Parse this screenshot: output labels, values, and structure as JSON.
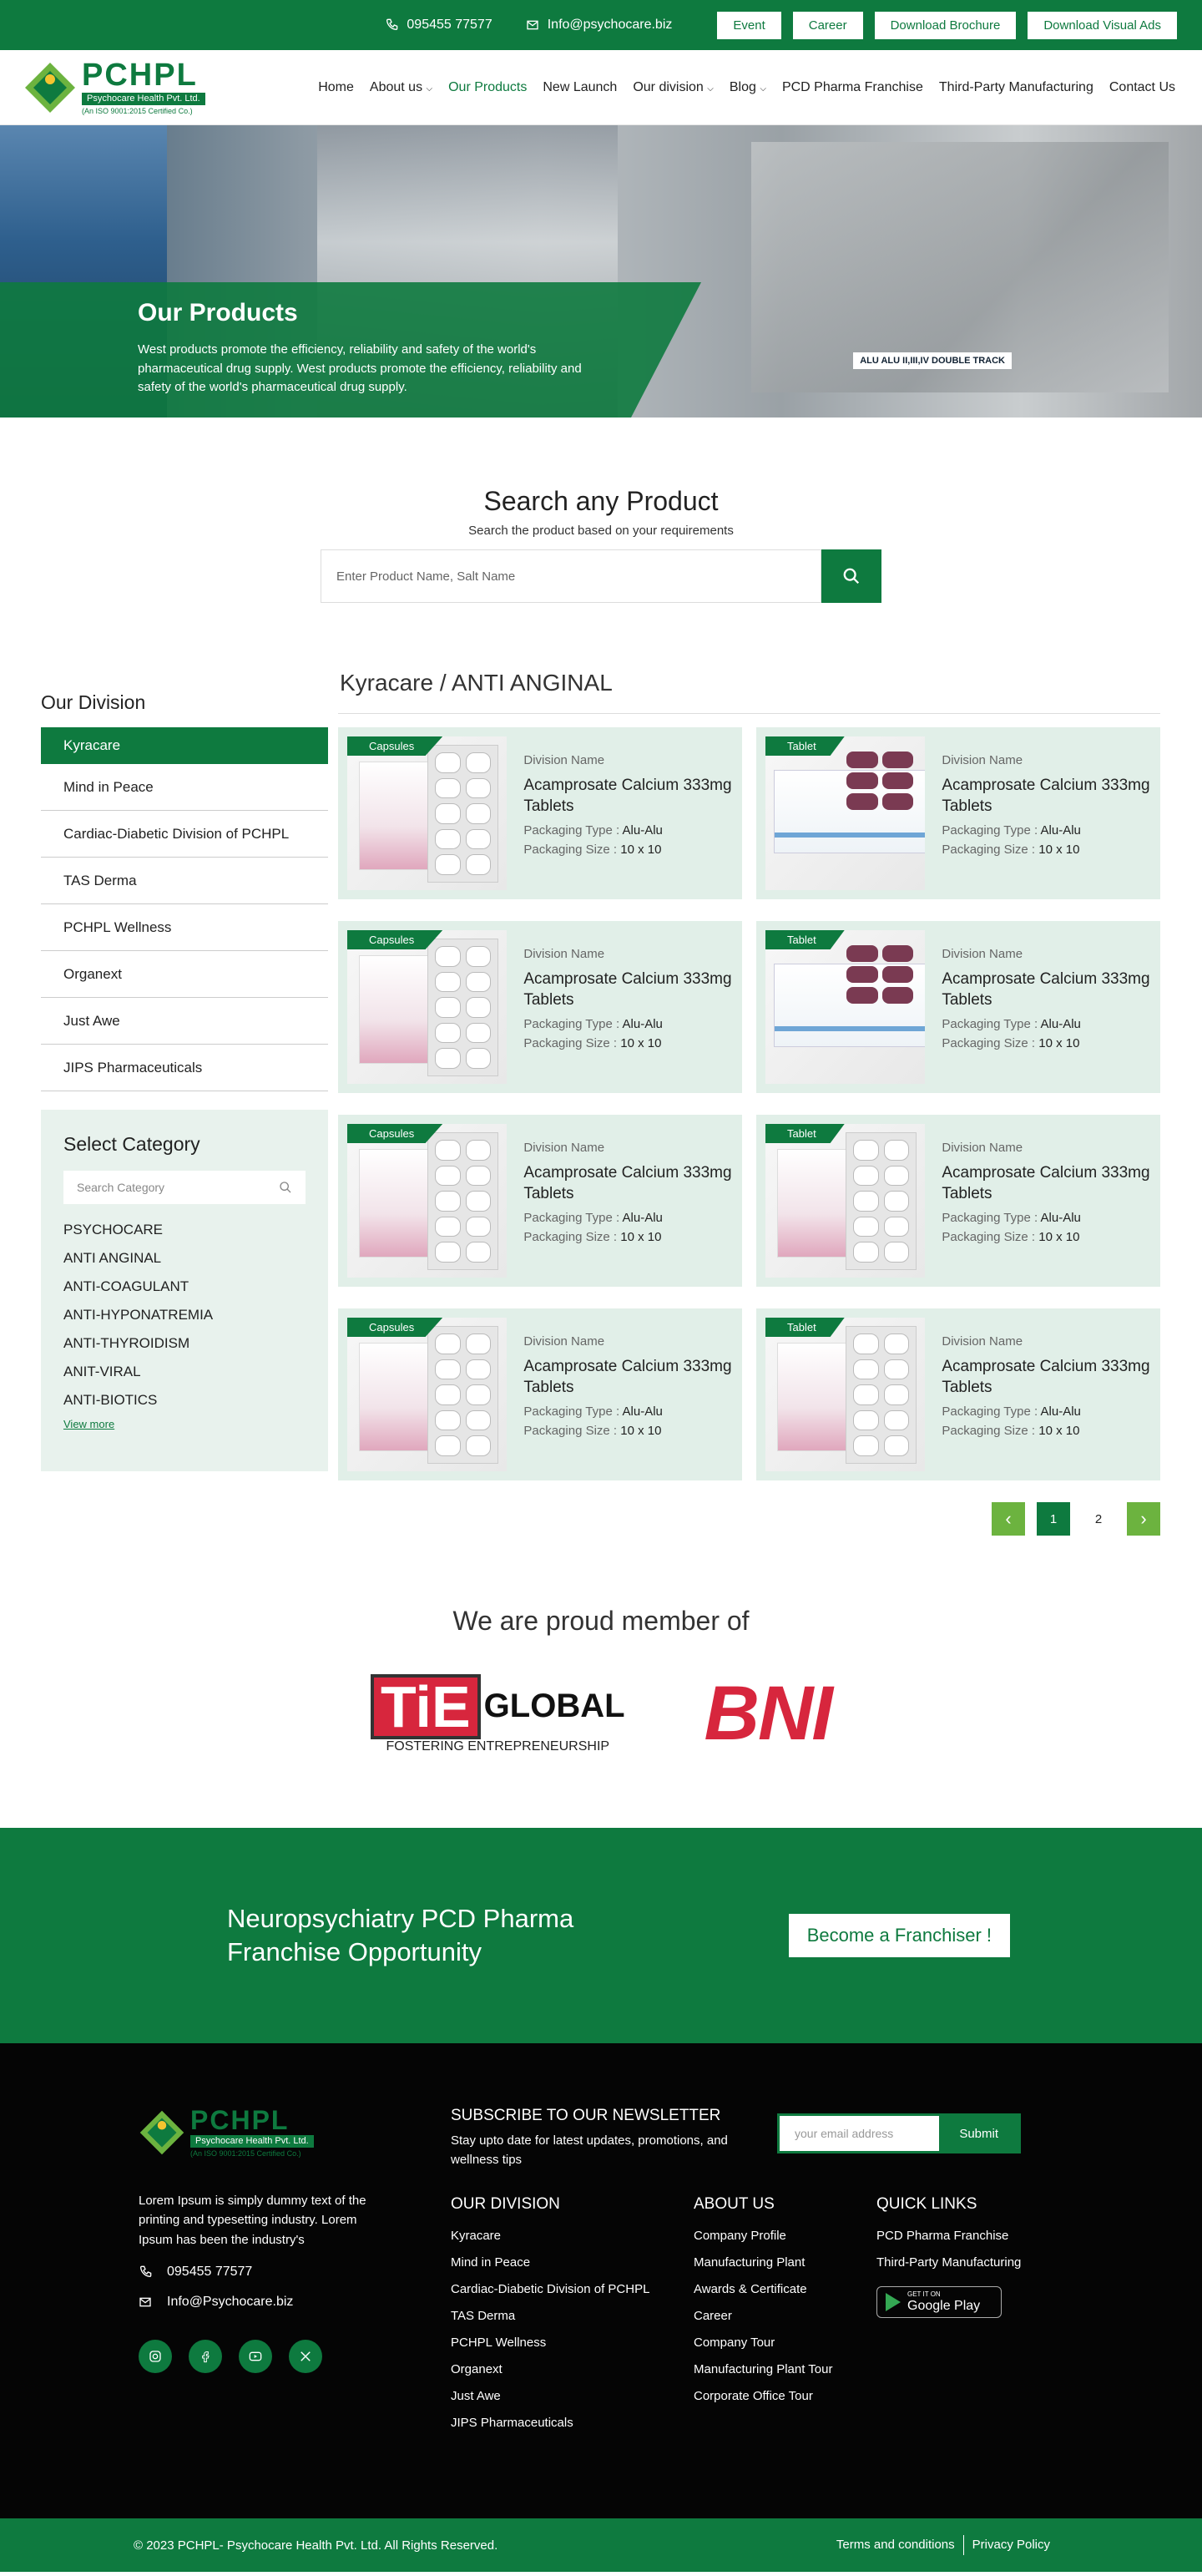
{
  "topbar": {
    "phone": "095455 77577",
    "email": "Info@psychocare.biz",
    "buttons": [
      "Event",
      "Career",
      "Download Brochure",
      "Download Visual Ads"
    ]
  },
  "logo": {
    "name": "PCHPL",
    "tagline": "Psychocare Health Pvt. Ltd.",
    "cert": "(An ISO 9001:2015 Certified Co.)"
  },
  "nav": {
    "items": [
      "Home",
      "About us",
      "Our Products",
      "New Launch",
      "Our division",
      "Blog",
      "PCD Pharma Franchise",
      "Third-Party Manufacturing",
      "Contact Us"
    ],
    "active": "Our Products"
  },
  "hero": {
    "title": "Our Products",
    "text": "West products promote the efficiency, reliability and safety of the world's pharmaceutical drug supply. West products promote the efficiency, reliability and safety of the world's pharmaceutical drug supply.",
    "tag": "ALU ALU II,III,IV DOUBLE TRACK"
  },
  "search": {
    "title": "Search any Product",
    "subtitle": "Search the product based on your requirements",
    "placeholder": "Enter Product Name, Salt Name"
  },
  "division": {
    "title": "Our Division",
    "items": [
      "Kyracare",
      "Mind in Peace",
      "Cardiac-Diabetic Division of PCHPL",
      "TAS Derma",
      "PCHPL Wellness",
      "Organext",
      "Just Awe",
      "JIPS Pharmaceuticals"
    ]
  },
  "category": {
    "title": "Select Category",
    "placeholder": "Search Category",
    "items": [
      "PSYCHOCARE",
      "ANTI ANGINAL",
      "ANTI-COAGULANT",
      "ANTI-HYPONATREMIA",
      "ANTI-THYROIDISM",
      "ANIT-VIRAL",
      "ANTI-BIOTICS"
    ],
    "more": "View more"
  },
  "breadcrumb": "Kyracare / ANTI ANGINAL",
  "products": [
    {
      "badge": "Capsules",
      "division": "Division Name",
      "name": "Acamprosate Calcium 333mg Tablets",
      "ptype_label": "Packaging Type :",
      "ptype": "Alu-Alu",
      "psize_label": "Packaging Size :",
      "psize": "10 x 10"
    },
    {
      "badge": "Tablet",
      "division": "Division Name",
      "name": "Acamprosate Calcium 333mg Tablets",
      "ptype_label": "Packaging Type :",
      "ptype": "Alu-Alu",
      "psize_label": "Packaging Size :",
      "psize": "10 x 10"
    },
    {
      "badge": "Capsules",
      "division": "Division Name",
      "name": "Acamprosate Calcium 333mg Tablets",
      "ptype_label": "Packaging Type :",
      "ptype": "Alu-Alu",
      "psize_label": "Packaging Size :",
      "psize": "10 x 10"
    },
    {
      "badge": "Tablet",
      "division": "Division Name",
      "name": "Acamprosate Calcium 333mg Tablets",
      "ptype_label": "Packaging Type :",
      "ptype": "Alu-Alu",
      "psize_label": "Packaging Size :",
      "psize": "10 x 10"
    },
    {
      "badge": "Capsules",
      "division": "Division Name",
      "name": "Acamprosate Calcium 333mg Tablets",
      "ptype_label": "Packaging Type :",
      "ptype": "Alu-Alu",
      "psize_label": "Packaging Size :",
      "psize": "10 x 10"
    },
    {
      "badge": "Tablet",
      "division": "Division Name",
      "name": "Acamprosate Calcium 333mg Tablets",
      "ptype_label": "Packaging Type :",
      "ptype": "Alu-Alu",
      "psize_label": "Packaging Size :",
      "psize": "10 x 10"
    },
    {
      "badge": "Capsules",
      "division": "Division Name",
      "name": "Acamprosate Calcium 333mg Tablets",
      "ptype_label": "Packaging Type :",
      "ptype": "Alu-Alu",
      "psize_label": "Packaging Size :",
      "psize": "10 x 10"
    },
    {
      "badge": "Tablet",
      "division": "Division Name",
      "name": "Acamprosate Calcium 333mg Tablets",
      "ptype_label": "Packaging Type :",
      "ptype": "Alu-Alu",
      "psize_label": "Packaging Size :",
      "psize": "10 x 10"
    }
  ],
  "pagination": {
    "pages": [
      "1",
      "2"
    ],
    "prev": "‹",
    "next": "›"
  },
  "members": {
    "title": "We are proud member of",
    "tie": {
      "mark": "TiE",
      "word": "GLOBAL",
      "sub": "FOSTERING ENTREPRENEURSHIP"
    },
    "bni": "BNI"
  },
  "franchise": {
    "title_line1": "Neuropsychiatry PCD Pharma",
    "title_line2": "Franchise Opportunity",
    "button": "Become a Franchiser !"
  },
  "footer": {
    "desc": "Lorem Ipsum is simply dummy text of the printing and typesetting industry. Lorem Ipsum has been the industry's",
    "phone": "095455 77577",
    "email": "Info@Psychocare.biz",
    "newsletter_title": "SUBSCRIBE TO OUR NEWSLETTER",
    "newsletter_text": "Stay upto date for latest updates, promotions, and wellness tips",
    "email_placeholder": "your email address",
    "submit": "Submit",
    "division_title": "OUR DIVISION",
    "division_items": [
      "Kyracare",
      "Mind in Peace",
      "Cardiac-Diabetic Division of PCHPL",
      "TAS Derma",
      "PCHPL Wellness",
      "Organext",
      "Just Awe",
      "JIPS Pharmaceuticals"
    ],
    "about_title": "ABOUT US",
    "about_items": [
      "Company Profile",
      "Manufacturing Plant",
      "Awards & Certificate",
      "Career",
      "Company Tour",
      "Manufacturing Plant Tour",
      "Corporate Office Tour"
    ],
    "quick_title": "QUICK LINKS",
    "quick_items": [
      "PCD Pharma Franchise",
      "Third-Party Manufacturing"
    ],
    "gplay_small": "GET IT ON",
    "gplay_big": "Google Play"
  },
  "bottom": {
    "copyright": "© 2023 PCHPL- Psychocare Health Pvt. Ltd. All Rights Reserved.",
    "terms": "Terms and conditions",
    "privacy": "Privacy Policy"
  },
  "colors": {
    "primary": "#0e7a3f",
    "accent": "#6cb33f",
    "card": "#e1efe8"
  }
}
